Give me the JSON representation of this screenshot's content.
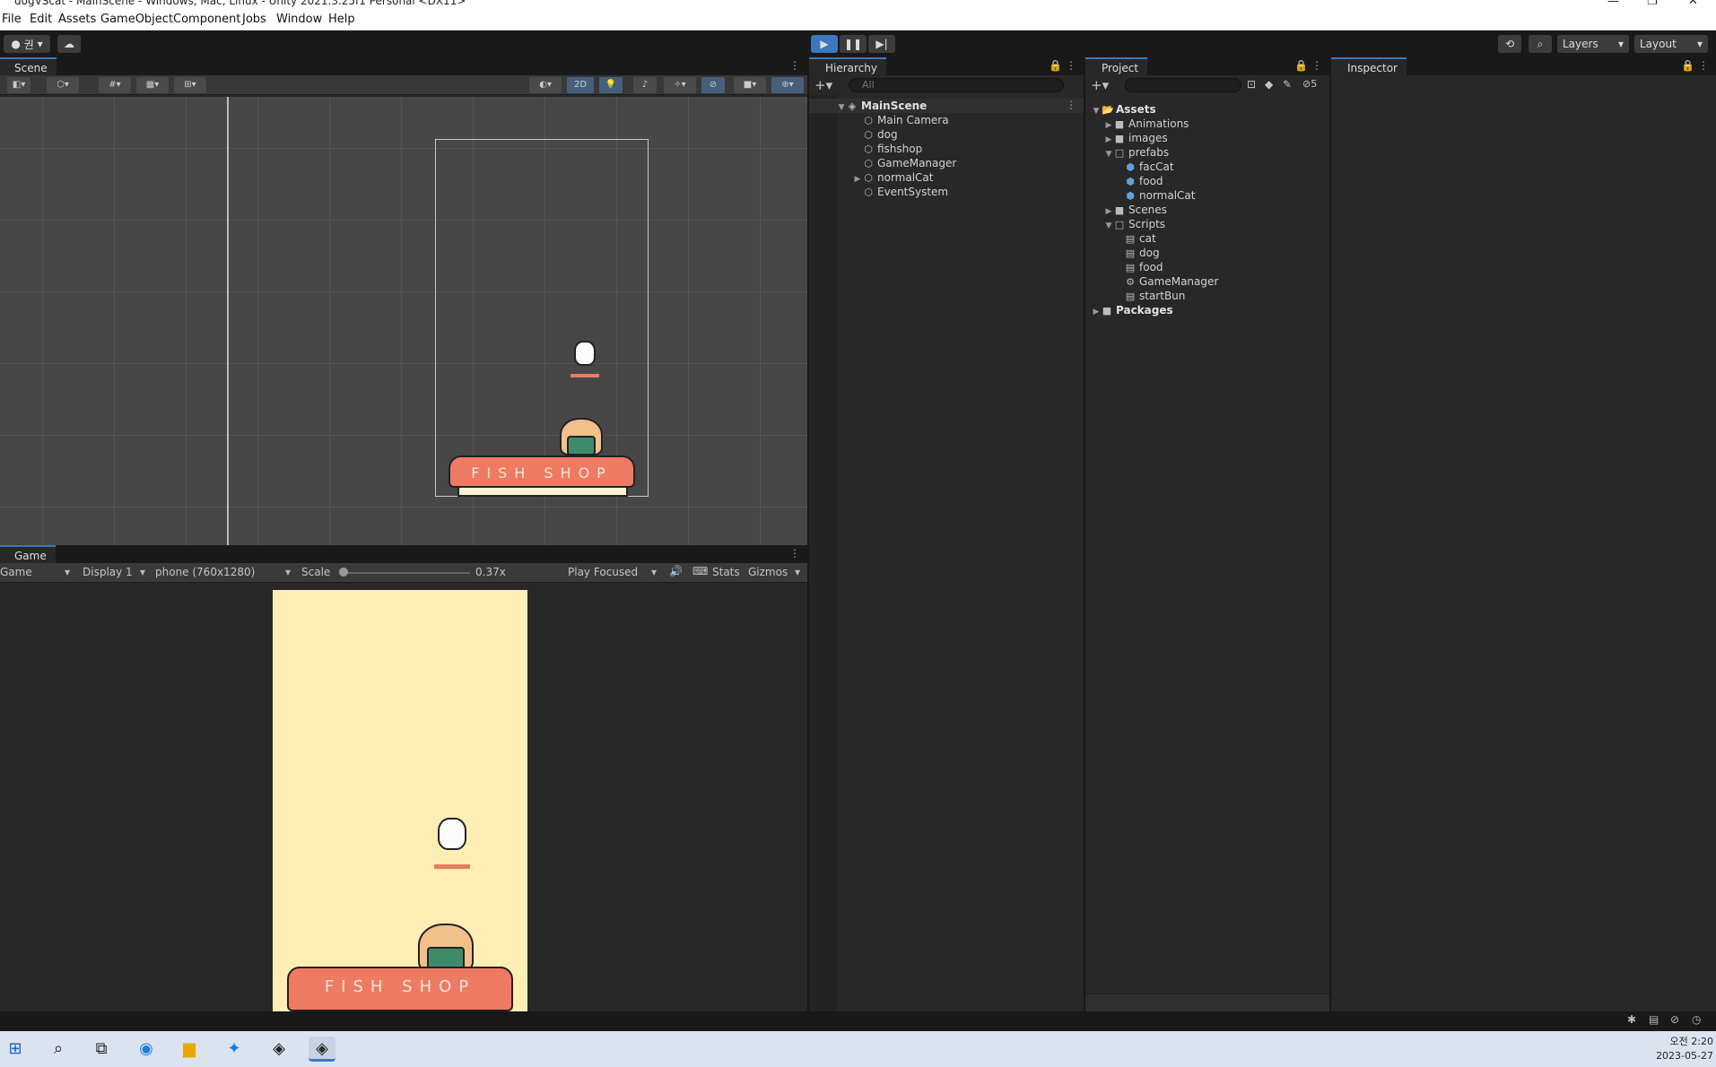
{
  "window": {
    "title": "dogVScat - MainScene - Windows, Mac, Linux - Unity 2021.3.25f1 Personal <DX11>",
    "minimize": "—",
    "maximize": "❐",
    "close": "✕"
  },
  "menu": [
    "File",
    "Edit",
    "Assets",
    "GameObject",
    "Component",
    "Jobs",
    "Window",
    "Help"
  ],
  "toolbar": {
    "account": "권",
    "layers_label": "Layers",
    "layout_label": "Layout"
  },
  "scene": {
    "tab_label": "Scene",
    "mode_2d": "2D"
  },
  "game": {
    "tab_label": "Game",
    "view_dropdown": "Game",
    "display_dropdown": "Display 1",
    "resolution_dropdown": "phone (760x1280)",
    "scale_label": "Scale",
    "scale_value": "0.37x",
    "scale_fraction": 0.0,
    "play_mode_dropdown": "Play Focused",
    "stats_label": "Stats",
    "gizmos_label": "Gizmos",
    "shop_text": "FISH SHOP"
  },
  "hierarchy": {
    "tab_label": "Hierarchy",
    "search_placeholder": "All",
    "scene_name": "MainScene",
    "items": [
      "Main Camera",
      "dog",
      "fishshop",
      "GameManager",
      "normalCat",
      "EventSystem"
    ]
  },
  "project": {
    "tab_label": "Project",
    "hidden_count": "5",
    "root": "Assets",
    "folders": [
      "Animations",
      "images",
      "prefabs",
      "Scenes",
      "Scripts"
    ],
    "prefabs": [
      "facCat",
      "food",
      "normalCat"
    ],
    "scripts": [
      "cat",
      "dog",
      "food",
      "GameManager",
      "startBun"
    ],
    "packages": "Packages"
  },
  "inspector": {
    "tab_label": "Inspector"
  },
  "taskbar": {
    "time_ampm": "오전 2:20",
    "date": "2023-05-27"
  }
}
